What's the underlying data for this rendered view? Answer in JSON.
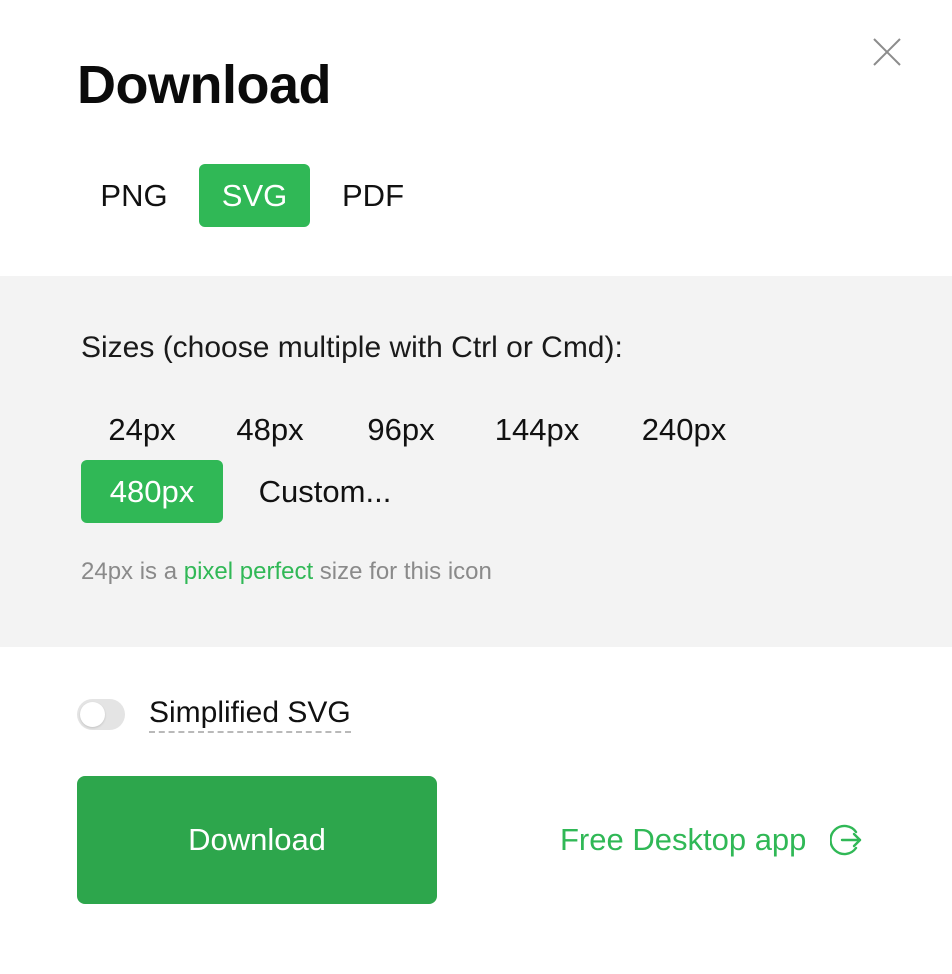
{
  "dialog": {
    "title": "Download",
    "close_icon": "close-icon"
  },
  "formats": {
    "tabs": [
      {
        "label": "PNG",
        "selected": false
      },
      {
        "label": "SVG",
        "selected": true
      },
      {
        "label": "PDF",
        "selected": false
      }
    ]
  },
  "sizes": {
    "heading": "Sizes (choose multiple with Ctrl or Cmd):",
    "options": [
      {
        "label": "24px",
        "selected": false
      },
      {
        "label": "48px",
        "selected": false
      },
      {
        "label": "96px",
        "selected": false
      },
      {
        "label": "144px",
        "selected": false
      },
      {
        "label": "240px",
        "selected": false
      },
      {
        "label": "480px",
        "selected": true
      },
      {
        "label": "Custom...",
        "selected": false
      }
    ],
    "hint": {
      "prefix": "24px is a ",
      "link": "pixel perfect",
      "suffix": " size for this icon"
    }
  },
  "simplified": {
    "label": "Simplified SVG",
    "enabled": false
  },
  "actions": {
    "download_label": "Download",
    "desktop_app_label": "Free Desktop app",
    "desktop_app_icon": "external-arrow-icon"
  },
  "colors": {
    "accent": "#30b856",
    "button": "#2da64c",
    "panel_bg": "#f3f3f3"
  }
}
